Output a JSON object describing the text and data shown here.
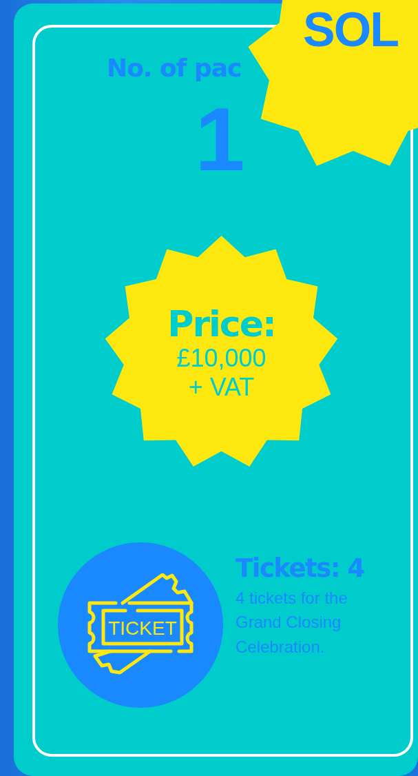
{
  "sold_badge": {
    "text": "SOL"
  },
  "packages": {
    "label": "No. of pac",
    "value": "1"
  },
  "price": {
    "label": "Price:",
    "amount": "£10,000",
    "suffix": "+ VAT"
  },
  "tickets": {
    "icon_text": "TICKET",
    "title": "Tickets: 4",
    "description": "4 tickets for the Grand Closing Celebration."
  }
}
